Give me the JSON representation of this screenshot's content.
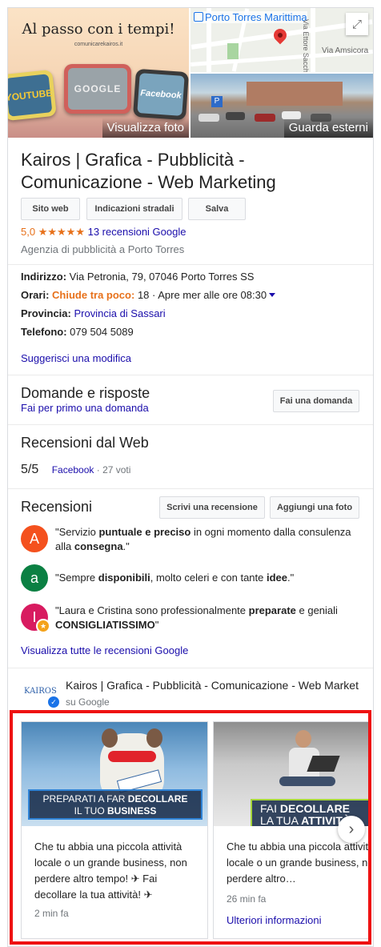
{
  "photos": {
    "main_tagline": "Al passo con i tempi!",
    "main_site": "comunicarekairos.it",
    "tv_labels": [
      "YOUTUBE",
      "GOOGLE",
      "Facebook"
    ],
    "view_photos_label": "Visualizza foto",
    "map_place_label": "Porto Torres Marittima",
    "map_street_vertical": "Via Ettore Sacchi",
    "map_street_horizontal": "Via Amsicora",
    "exterior_label": "Guarda esterni"
  },
  "business": {
    "title": "Kairos | Grafica - Pubblicità - Comunicazione - Web Marketing",
    "buttons": {
      "website": "Sito web",
      "directions": "Indicazioni stradali",
      "save": "Salva"
    },
    "rating": "5,0",
    "stars": "★★★★★",
    "reviews_link": "13 recensioni Google",
    "category": "Agenzia di pubblicità a Porto Torres"
  },
  "info": {
    "address_label": "Indirizzo:",
    "address_value": "Via Petronia, 79, 07046 Porto Torres SS",
    "hours_label": "Orari:",
    "hours_status": "Chiude tra poco:",
    "hours_value": "18 · Apre mer alle ore 08:30",
    "province_label": "Provincia:",
    "province_value": "Provincia di Sassari",
    "phone_label": "Telefono:",
    "phone_value": "079 504 5089",
    "suggest_edit": "Suggerisci una modifica"
  },
  "qa": {
    "heading": "Domande e risposte",
    "first_ask": "Fai per primo una domanda",
    "ask_button": "Fai una domanda"
  },
  "web_reviews": {
    "heading": "Recensioni dal Web",
    "score": "5/5",
    "source": "Facebook",
    "votes": " · 27 voti"
  },
  "reviews": {
    "heading": "Recensioni",
    "write_button": "Scrivi una recensione",
    "add_photo_button": "Aggiungi una foto",
    "items": [
      {
        "avatar_letter": "A",
        "avatar_color": "#f4511e",
        "parts": [
          "\"Servizio ",
          "puntuale e preciso",
          " in ogni momento dalla consulenza alla ",
          "consegna",
          ".\""
        ]
      },
      {
        "avatar_letter": "a",
        "avatar_color": "#0b8043",
        "parts": [
          "\"Sempre ",
          "disponibili",
          ", molto celeri e con tante ",
          "idee",
          ".\""
        ]
      },
      {
        "avatar_letter": "I",
        "avatar_color": "#d81b60",
        "parts": [
          "\"Laura e Cristina sono professionalmente ",
          "preparate",
          " e geniali ",
          "CONSIGLIATISSIMO",
          "\""
        ]
      }
    ],
    "see_all": "Visualizza tutte le recensioni Google"
  },
  "posts": {
    "logo_text": "KAIROS",
    "business_name": "Kairos | Grafica - Pubblicità - Comunicazione - Web Market",
    "on_google": "su Google",
    "cards": [
      {
        "banner_line1_a": "PREPARATI A FAR ",
        "banner_line1_b": "DECOLLARE",
        "banner_line2_a": "IL TUO ",
        "banner_line2_b": "BUSINESS",
        "text": "Che tu abbia una piccola attività locale o un grande business, non perdere altro tempo! ✈ Fai decollare la tua attività! ✈",
        "time": "2 min fa"
      },
      {
        "banner_line1_a": "FAI ",
        "banner_line1_b": "DECOLLARE",
        "banner_line2_a": "LA TUA ",
        "banner_line2_b": "ATTIVITÀ",
        "text": "Che tu abbia una piccola attività locale o un grande business, non perdere altro…",
        "time": "26 min fa",
        "more": "Ulteriori informazioni"
      }
    ]
  },
  "colors": {
    "accent_orange": "#e7711b",
    "link_blue": "#1a0dab",
    "highlight_red": "#ee1111"
  }
}
